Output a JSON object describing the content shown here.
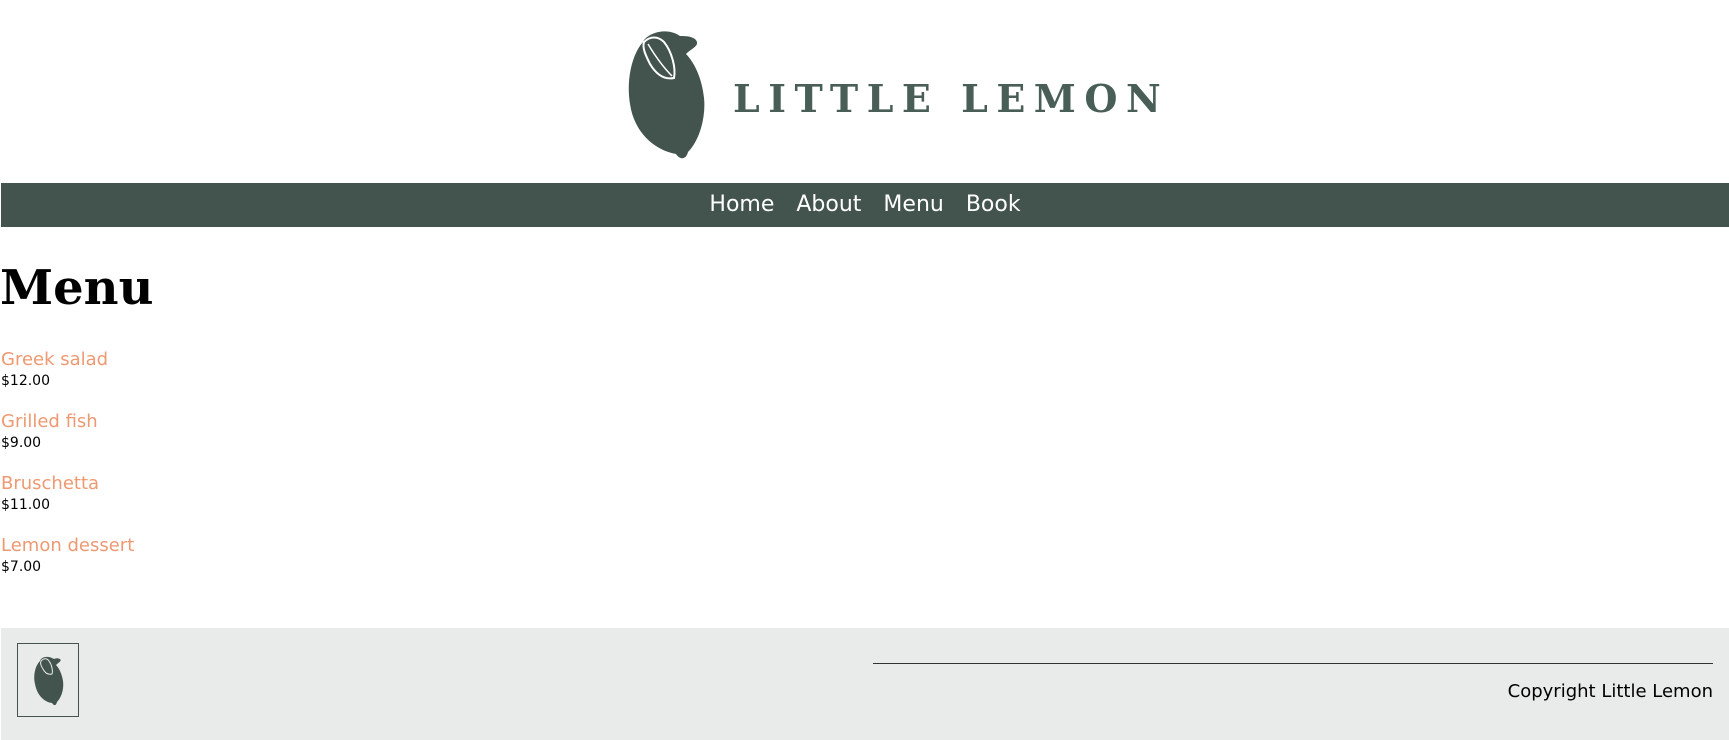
{
  "brand": {
    "name": "LITTLE LEMON",
    "primary_color": "#495e57",
    "accent_color": "#ee9972",
    "logo_icon": "lemon-icon"
  },
  "nav": {
    "items": [
      {
        "label": "Home"
      },
      {
        "label": "About"
      },
      {
        "label": "Menu"
      },
      {
        "label": "Book"
      }
    ]
  },
  "main": {
    "title": "Menu",
    "items": [
      {
        "name": "Greek salad",
        "price": "$12.00"
      },
      {
        "name": "Grilled fish",
        "price": "$9.00"
      },
      {
        "name": "Bruschetta",
        "price": "$11.00"
      },
      {
        "name": "Lemon dessert",
        "price": "$7.00"
      }
    ]
  },
  "footer": {
    "logo_icon": "lemon-icon",
    "copyright": "Copyright Little Lemon"
  }
}
